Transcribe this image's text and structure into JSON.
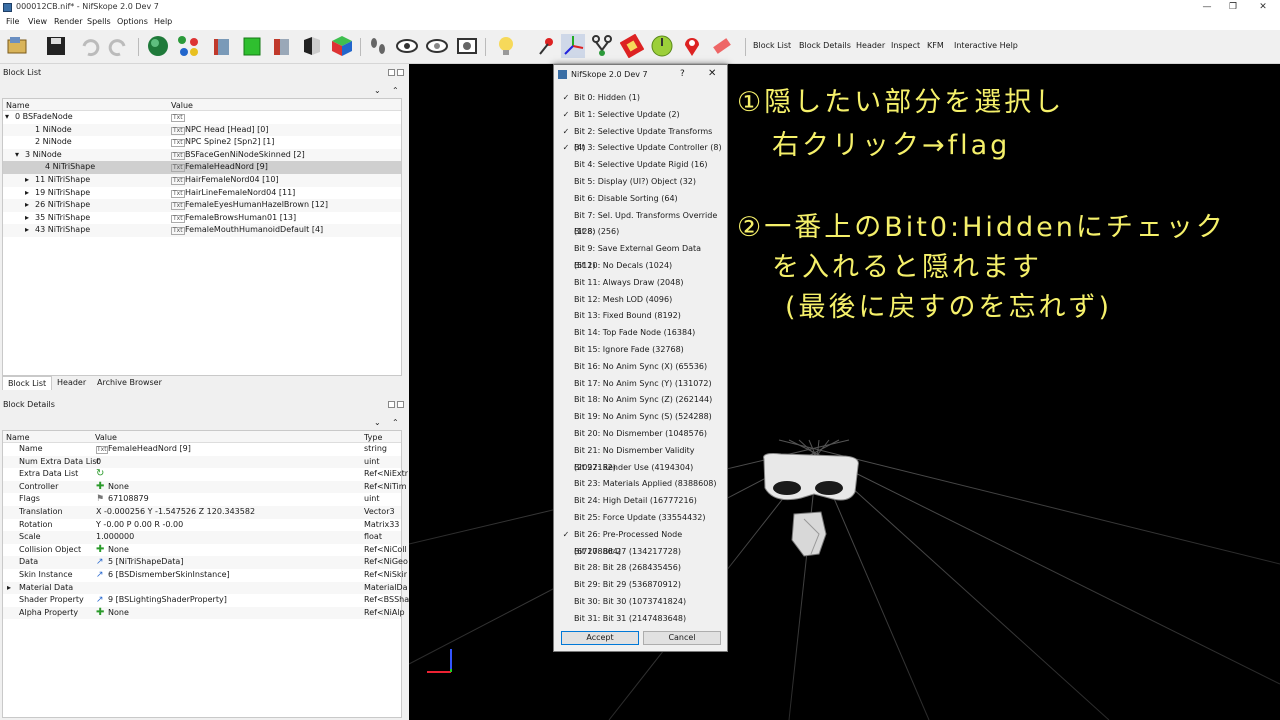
{
  "window": {
    "title": "000012CB.nif* - NifSkope 2.0 Dev 7",
    "controls": [
      "—",
      "❐",
      "✕"
    ]
  },
  "menu": [
    "File",
    "View",
    "Render",
    "Spells",
    "Options",
    "Help"
  ],
  "toolbar": {
    "icons": [
      "load-icon",
      "save-icon",
      "undo-icon",
      "redo-icon",
      "sphere-icon",
      "nodes-icon",
      "cube-red-icon",
      "cube-green-icon",
      "cube-red2-icon",
      "cube-split-icon",
      "cube-color-icon",
      "footprints-icon",
      "eye-icon",
      "eye-outline-icon",
      "screenshot-icon",
      "bulb-icon",
      "pin-red-icon",
      "axes-icon",
      "tree-icon",
      "flag-icon",
      "circle-green-icon",
      "location-icon",
      "eraser-icon"
    ],
    "text_buttons": [
      "Block List",
      "Block Details",
      "Header",
      "Inspect",
      "KFM",
      "Interactive Help"
    ]
  },
  "block_list": {
    "title": "Block List",
    "columns": [
      "Name",
      "Value"
    ],
    "rows": [
      {
        "name": "0 BSFadeNode",
        "value": "",
        "tag": "Txt",
        "indent": 0,
        "arrow": "▾"
      },
      {
        "name": "1 NiNode",
        "value": "NPC Head [Head] [0]",
        "tag": "Txt",
        "indent": 2,
        "arrow": ""
      },
      {
        "name": "2 NiNode",
        "value": "NPC Spine2 [Spn2] [1]",
        "tag": "Txt",
        "indent": 2,
        "arrow": ""
      },
      {
        "name": "3 NiNode",
        "value": "BSFaceGenNiNodeSkinned [2]",
        "tag": "Txt",
        "indent": 1,
        "arrow": "▾"
      },
      {
        "name": "4 NiTriShape",
        "value": "FemaleHeadNord [9]",
        "tag": "Txt",
        "indent": 3,
        "arrow": ""
      },
      {
        "name": "11 NiTriShape",
        "value": "HairFemaleNord04 [10]",
        "tag": "Txt",
        "indent": 2,
        "arrow": "▸"
      },
      {
        "name": "19 NiTriShape",
        "value": "HairLineFemaleNord04 [11]",
        "tag": "Txt",
        "indent": 2,
        "arrow": "▸"
      },
      {
        "name": "26 NiTriShape",
        "value": "FemaleEyesHumanHazelBrown [12]",
        "tag": "Txt",
        "indent": 2,
        "arrow": "▸"
      },
      {
        "name": "35 NiTriShape",
        "value": "FemaleBrowsHuman01 [13]",
        "tag": "Txt",
        "indent": 2,
        "arrow": "▸"
      },
      {
        "name": "43 NiTriShape",
        "value": "FemaleMouthHumanoidDefault [4]",
        "tag": "Txt",
        "indent": 2,
        "arrow": "▸"
      }
    ],
    "tabs": [
      "Block List",
      "Header",
      "Archive Browser"
    ]
  },
  "block_details": {
    "title": "Block Details",
    "columns": [
      "Name",
      "Value",
      "Type"
    ],
    "rows": [
      {
        "name": "Name",
        "value": "FemaleHeadNord [9]",
        "type": "string",
        "icon": "txt",
        "arrow": ""
      },
      {
        "name": "Num Extra Data List",
        "value": "0",
        "type": "uint",
        "icon": "",
        "arrow": ""
      },
      {
        "name": "Extra Data List",
        "value": "",
        "type": "Ref<NiExtr",
        "icon": "refresh",
        "arrow": ""
      },
      {
        "name": "Controller",
        "value": "None",
        "type": "Ref<NiTim",
        "icon": "plus",
        "arrow": ""
      },
      {
        "name": "Flags",
        "value": "67108879",
        "type": "uint",
        "icon": "flag",
        "arrow": ""
      },
      {
        "name": "Translation",
        "value": "X -0.000256 Y -1.547526 Z 120.343582",
        "type": "Vector3",
        "icon": "",
        "arrow": ""
      },
      {
        "name": "Rotation",
        "value": "Y -0.00 P 0.00 R -0.00",
        "type": "Matrix33",
        "icon": "",
        "arrow": ""
      },
      {
        "name": "Scale",
        "value": "1.000000",
        "type": "float",
        "icon": "",
        "arrow": ""
      },
      {
        "name": "Collision Object",
        "value": "None",
        "type": "Ref<NiColl",
        "icon": "plus",
        "arrow": ""
      },
      {
        "name": "Data",
        "value": "5 [NiTriShapeData]",
        "type": "Ref<NiGeo",
        "icon": "link",
        "arrow": ""
      },
      {
        "name": "Skin Instance",
        "value": "6 [BSDismemberSkinInstance]",
        "type": "Ref<NiSkir",
        "icon": "link",
        "arrow": ""
      },
      {
        "name": "Material Data",
        "value": "",
        "type": "MaterialDa",
        "icon": "",
        "arrow": "▸"
      },
      {
        "name": "Shader Property",
        "value": "9 [BSLightingShaderProperty]",
        "type": "Ref<BSSha",
        "icon": "link",
        "arrow": ""
      },
      {
        "name": "Alpha Property",
        "value": "None",
        "type": "Ref<NiAlp",
        "icon": "plus",
        "arrow": ""
      }
    ]
  },
  "dialog": {
    "title": "NifSkope 2.0 Dev 7",
    "help": "?",
    "close": "✕",
    "bits": [
      {
        "label": "Bit 0: Hidden (1)",
        "checked": true
      },
      {
        "label": "Bit 1: Selective Update (2)",
        "checked": true
      },
      {
        "label": "Bit 2: Selective Update Transforms (4)",
        "checked": true
      },
      {
        "label": "Bit 3: Selective Update Controller (8)",
        "checked": true
      },
      {
        "label": "Bit 4: Selective Update Rigid (16)",
        "checked": false
      },
      {
        "label": "Bit 5: Display (UI?) Object (32)",
        "checked": false
      },
      {
        "label": "Bit 6: Disable Sorting (64)",
        "checked": false
      },
      {
        "label": "Bit 7: Sel. Upd. Transforms Override (128)",
        "checked": false
      },
      {
        "label": "Bit 8:  (256)",
        "checked": false
      },
      {
        "label": "Bit 9: Save External Geom Data (512)",
        "checked": false
      },
      {
        "label": "Bit 10: No Decals (1024)",
        "checked": false
      },
      {
        "label": "Bit 11: Always Draw (2048)",
        "checked": false
      },
      {
        "label": "Bit 12: Mesh LOD (4096)",
        "checked": false
      },
      {
        "label": "Bit 13: Fixed Bound (8192)",
        "checked": false
      },
      {
        "label": "Bit 14: Top Fade Node (16384)",
        "checked": false
      },
      {
        "label": "Bit 15: Ignore Fade (32768)",
        "checked": false
      },
      {
        "label": "Bit 16: No Anim Sync (X) (65536)",
        "checked": false
      },
      {
        "label": "Bit 17: No Anim Sync (Y) (131072)",
        "checked": false
      },
      {
        "label": "Bit 18: No Anim Sync (Z) (262144)",
        "checked": false
      },
      {
        "label": "Bit 19: No Anim Sync (S) (524288)",
        "checked": false
      },
      {
        "label": "Bit 20: No Dismember (1048576)",
        "checked": false
      },
      {
        "label": "Bit 21: No Dismember Validity (2097152)",
        "checked": false
      },
      {
        "label": "Bit 22: Render Use (4194304)",
        "checked": false
      },
      {
        "label": "Bit 23: Materials Applied (8388608)",
        "checked": false
      },
      {
        "label": "Bit 24: High Detail (16777216)",
        "checked": false
      },
      {
        "label": "Bit 25: Force Update (33554432)",
        "checked": false
      },
      {
        "label": "Bit 26: Pre-Processed Node (67108864)",
        "checked": true
      },
      {
        "label": "Bit 27: Bit 27 (134217728)",
        "checked": false
      },
      {
        "label": "Bit 28: Bit 28 (268435456)",
        "checked": false
      },
      {
        "label": "Bit 29: Bit 29 (536870912)",
        "checked": false
      },
      {
        "label": "Bit 30: Bit 30 (1073741824)",
        "checked": false
      },
      {
        "label": "Bit 31: Bit 31 (2147483648)",
        "checked": false
      }
    ],
    "accept": "Accept",
    "cancel": "Cancel"
  },
  "annotation": {
    "color": "#f5f06a",
    "lines": [
      "①隠したい部分を選択し",
      "右クリック→flag",
      "②一番上のBit0:Hiddenにチェック",
      "を入れると隠れます",
      "(最後に戻すのを忘れず)"
    ]
  }
}
